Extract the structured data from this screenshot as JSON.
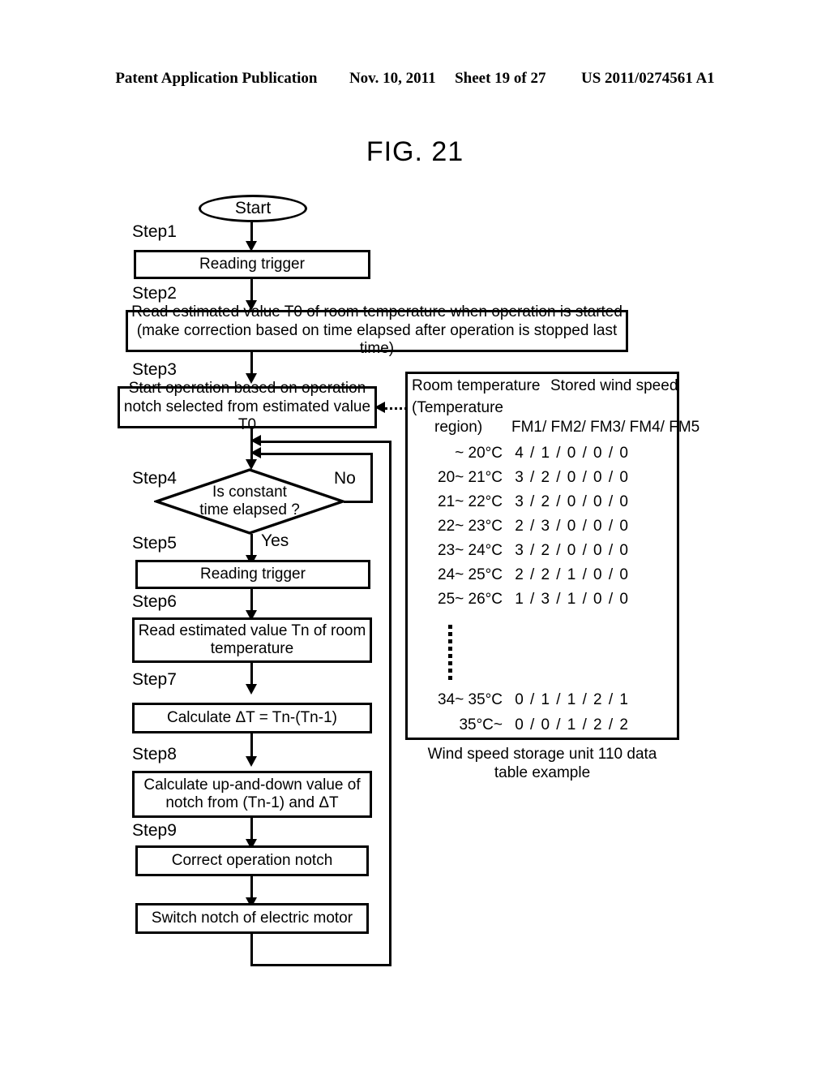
{
  "header": {
    "publication": "Patent Application Publication",
    "date": "Nov. 10, 2011",
    "sheet": "Sheet 19 of 27",
    "docnum": "US 2011/0274561 A1"
  },
  "figure": {
    "title": "FIG. 21"
  },
  "flowchart": {
    "start_label": "Start",
    "steps": [
      {
        "label": "Step1",
        "text": "Reading trigger"
      },
      {
        "label": "Step2",
        "text": "Read estimated value T0 of room temperature when operation is started\n(make correction based on time elapsed after operation is stopped last time)"
      },
      {
        "label": "Step3",
        "text": "Start operation based on operation\nnotch selected from estimated value T0"
      },
      {
        "label": "Step4",
        "text": "Is constant\ntime elapsed ?"
      },
      {
        "label": "Step5",
        "text": "Reading trigger"
      },
      {
        "label": "Step6",
        "text": "Read estimated value Tn of room\ntemperature"
      },
      {
        "label": "Step7",
        "text": "Calculate ΔT = Tn-(Tn-1)"
      },
      {
        "label": "Step8",
        "text": "Calculate up-and-down value of\nnotch from (Tn-1) and ΔT"
      },
      {
        "label": "Step9",
        "text": "Correct operation notch"
      }
    ],
    "final_step_text": "Switch notch of electric motor",
    "branch_no": "No",
    "branch_yes": "Yes"
  },
  "table": {
    "title_left": "Room temperature",
    "title_right": "Stored wind speed",
    "subtitle_line1": "(Temperature",
    "subtitle_line2": "region)",
    "columns": "FM1/ FM2/ FM3/ FM4/ FM5",
    "column_names": [
      "FM1",
      "FM2",
      "FM3",
      "FM4",
      "FM5"
    ],
    "rows": [
      {
        "range": "~ 20°C",
        "values": [
          "4",
          "1",
          "0",
          "0",
          "0"
        ]
      },
      {
        "range": "20~ 21°C",
        "values": [
          "3",
          "2",
          "0",
          "0",
          "0"
        ]
      },
      {
        "range": "21~ 22°C",
        "values": [
          "3",
          "2",
          "0",
          "0",
          "0"
        ]
      },
      {
        "range": "22~ 23°C",
        "values": [
          "2",
          "3",
          "0",
          "0",
          "0"
        ]
      },
      {
        "range": "23~ 24°C",
        "values": [
          "3",
          "2",
          "0",
          "0",
          "0"
        ]
      },
      {
        "range": "24~ 25°C",
        "values": [
          "2",
          "2",
          "1",
          "0",
          "0"
        ]
      },
      {
        "range": "25~ 26°C",
        "values": [
          "1",
          "3",
          "1",
          "0",
          "0"
        ]
      }
    ],
    "rows_tail": [
      {
        "range": "34~ 35°C",
        "values": [
          "0",
          "1",
          "1",
          "2",
          "1"
        ]
      },
      {
        "range": "35°C~",
        "values": [
          "0",
          "0",
          "1",
          "2",
          "2"
        ]
      }
    ],
    "ellipsis": "⋮",
    "caption": "Wind speed storage unit 110 data\ntable example"
  },
  "colors": {
    "ink": "#000000",
    "paper": "#ffffff"
  }
}
